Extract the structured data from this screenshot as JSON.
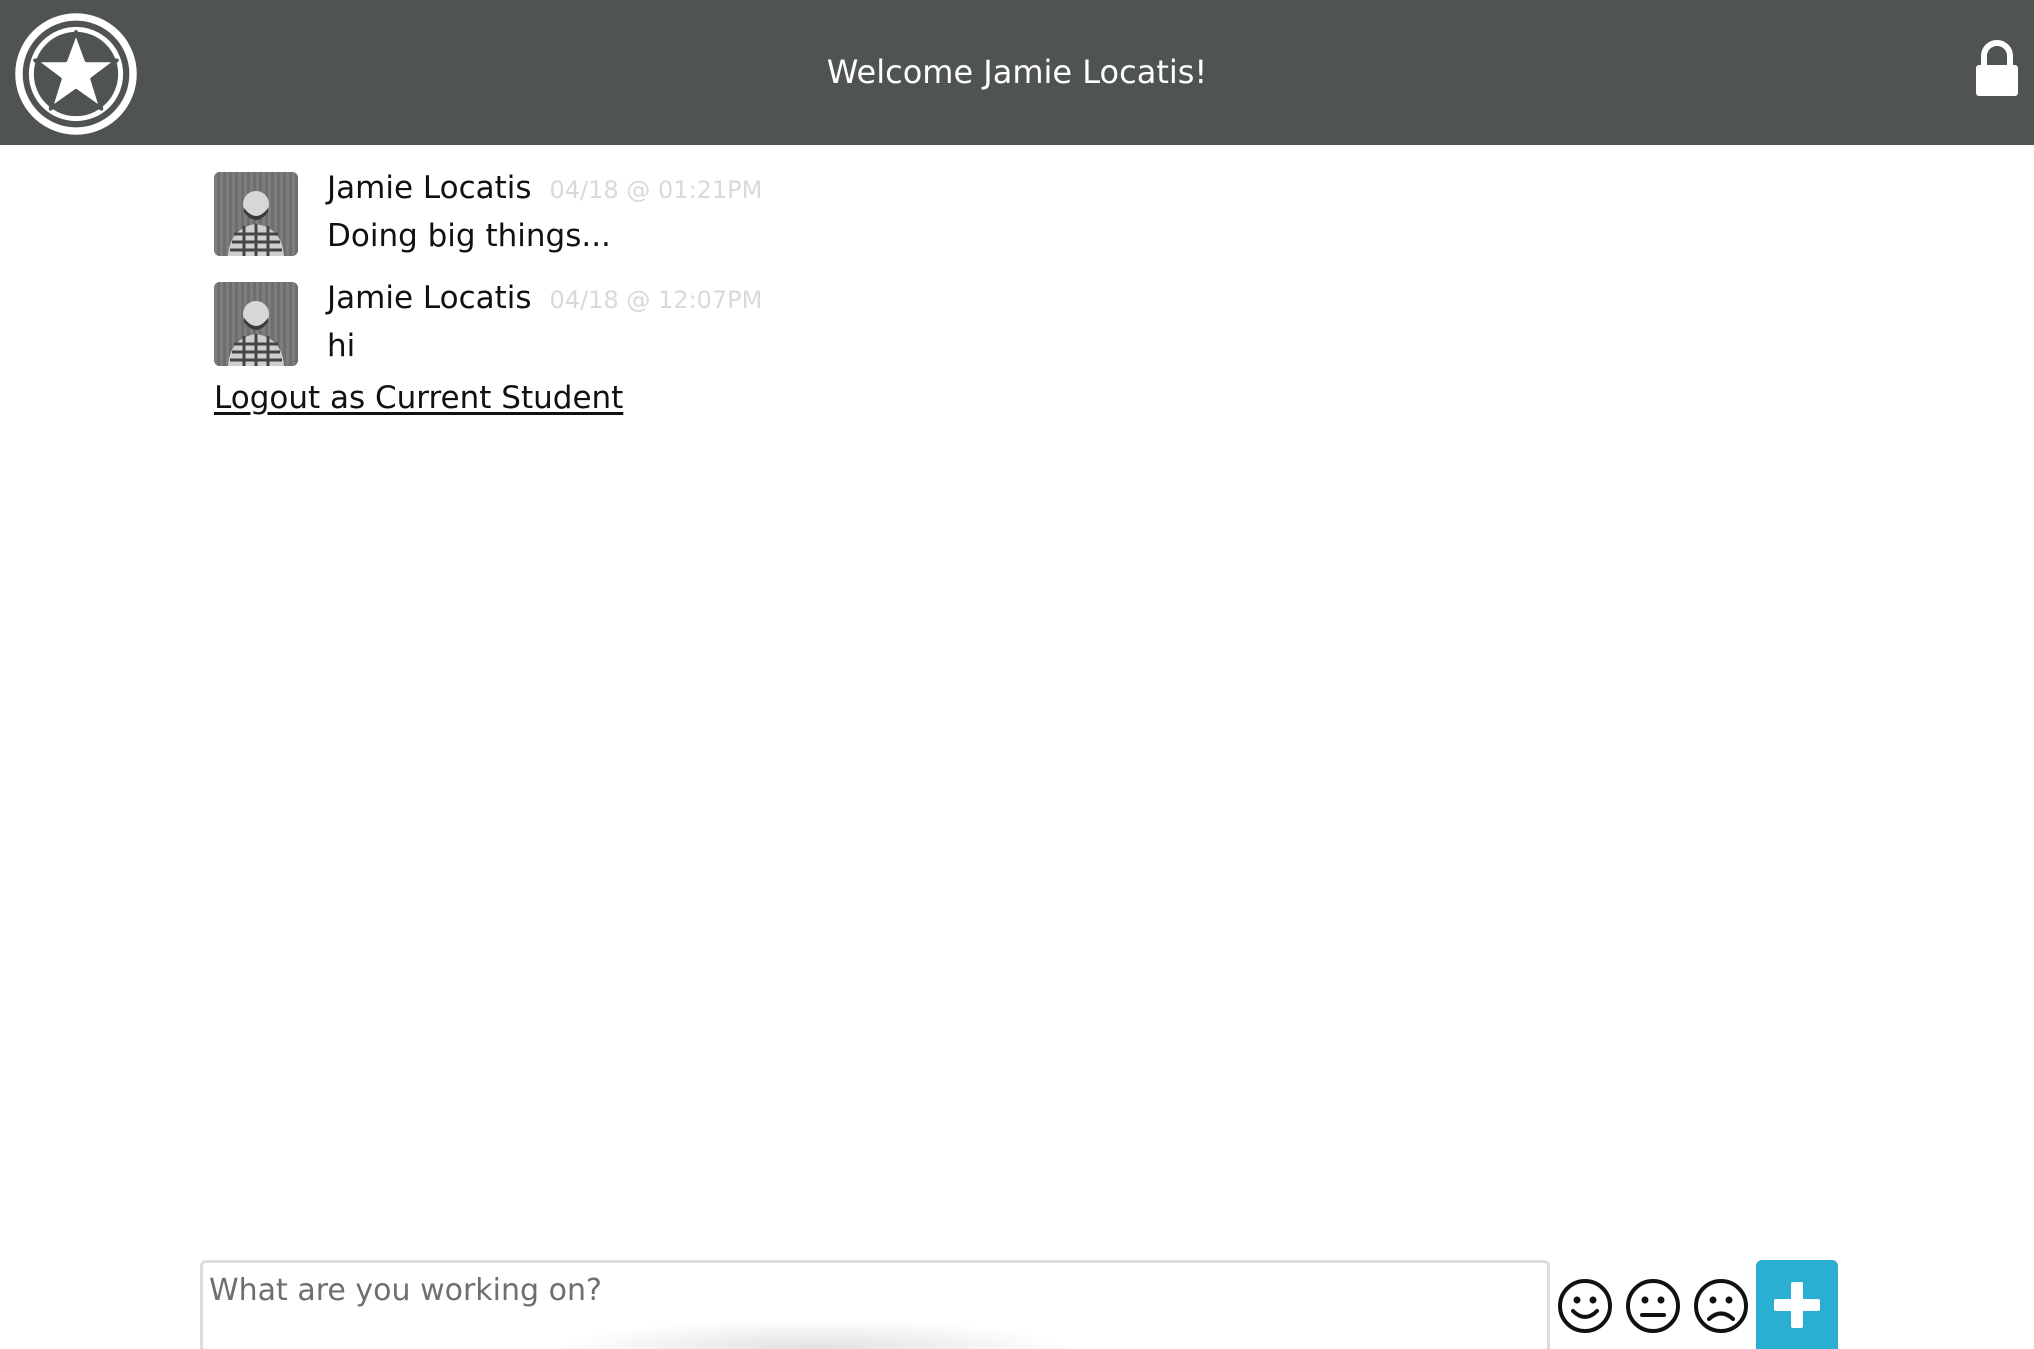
{
  "header": {
    "title": "Welcome Jamie Locatis!",
    "logo_icon": "star-badge-icon",
    "lock_icon": "lock-icon",
    "background_color": "#4f5353"
  },
  "messages": [
    {
      "author": "Jamie Locatis",
      "timestamp": "04/18 @ 01:21PM",
      "text": "Doing big things...",
      "avatar_icon": "user-avatar"
    },
    {
      "author": "Jamie Locatis",
      "timestamp": "04/18 @ 12:07PM",
      "text": "hi",
      "avatar_icon": "user-avatar"
    }
  ],
  "logout_link": "Logout as Current Student",
  "composer": {
    "placeholder": "What are you working on?",
    "value": "",
    "moods": [
      "happy-face-icon",
      "neutral-face-icon",
      "sad-face-icon"
    ],
    "add_icon": "plus-icon",
    "accent_color": "#2aaed1"
  }
}
